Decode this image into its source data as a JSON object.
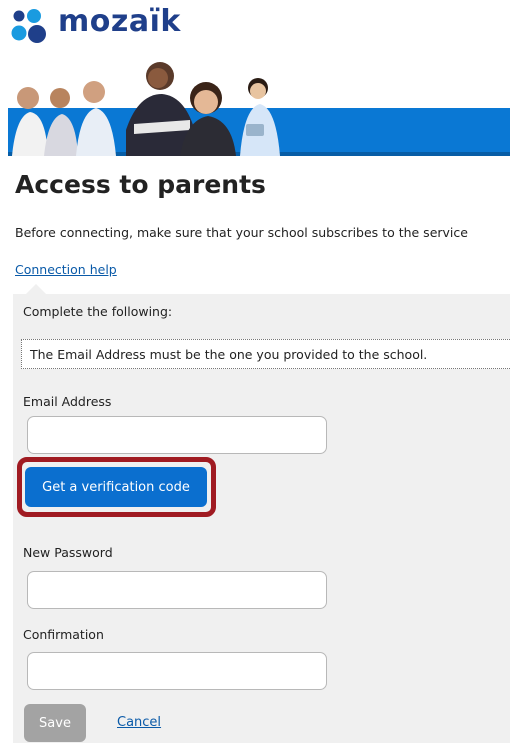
{
  "brand": {
    "name": "mozaïk",
    "logo_icon": "mozaik-dots-logo",
    "text_color": "#1f3f8a",
    "mark_colors": [
      "#1f3f8a",
      "#1a9be0"
    ]
  },
  "banner": {
    "image": "banner-people-photo",
    "band_color": "#0a78d4"
  },
  "page": {
    "title": "Access to parents",
    "intro": "Before connecting, make sure that your school subscribes to the service",
    "help_link": "Connection help"
  },
  "form": {
    "instruction": "Complete the following:",
    "notice": "The Email Address must be the one you provided to the school.",
    "email_label": "Email Address",
    "email_value": "",
    "verify_button": "Get a verification code",
    "new_password_label": "New Password",
    "new_password_value": "",
    "confirmation_label": "Confirmation",
    "confirmation_value": "",
    "save_button": "Save",
    "cancel_link": "Cancel"
  },
  "colors": {
    "accent": "#0b6fcf",
    "highlight": "#a01b22",
    "panel": "#f0f0f0",
    "disabled": "#a3a3a3",
    "link": "#0a5aa8"
  }
}
